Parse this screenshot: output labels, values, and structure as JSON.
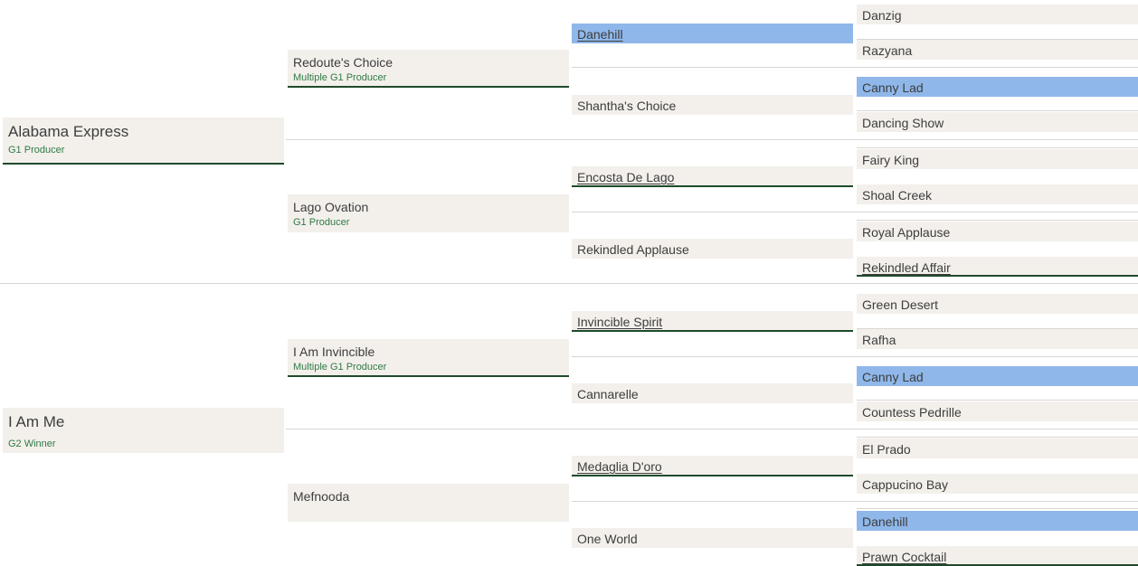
{
  "sire": {
    "name": "Alabama Express",
    "award": "G1 Producer",
    "sire": {
      "name": "Redoute's Choice",
      "award": "Multiple G1 Producer",
      "sire": {
        "name": "Danehill",
        "sire": "Danzig",
        "dam": "Razyana"
      },
      "dam": {
        "name": "Shantha's Choice",
        "sire": "Canny Lad",
        "dam": "Dancing Show"
      }
    },
    "dam": {
      "name": "Lago Ovation",
      "award": "G1 Producer",
      "sire": {
        "name": "Encosta De Lago",
        "sire": "Fairy King",
        "dam": "Shoal Creek"
      },
      "dam": {
        "name": "Rekindled Applause",
        "sire": "Royal Applause",
        "dam": "Rekindled Affair"
      }
    }
  },
  "dam": {
    "name": "I Am Me",
    "award": "G2 Winner",
    "sire": {
      "name": "I Am Invincible",
      "award": "Multiple G1 Producer",
      "sire": {
        "name": "Invincible Spirit",
        "sire": "Green Desert",
        "dam": "Rafha"
      },
      "dam": {
        "name": "Cannarelle",
        "sire": "Canny Lad",
        "dam": "Countess Pedrille"
      }
    },
    "dam": {
      "name": "Mefnooda",
      "sire": {
        "name": "Medaglia D'oro",
        "sire": "El Prado",
        "dam": "Cappucino Bay"
      },
      "dam": {
        "name": "One World",
        "sire": "Danehill",
        "dam": "Prawn Cocktail"
      }
    }
  }
}
